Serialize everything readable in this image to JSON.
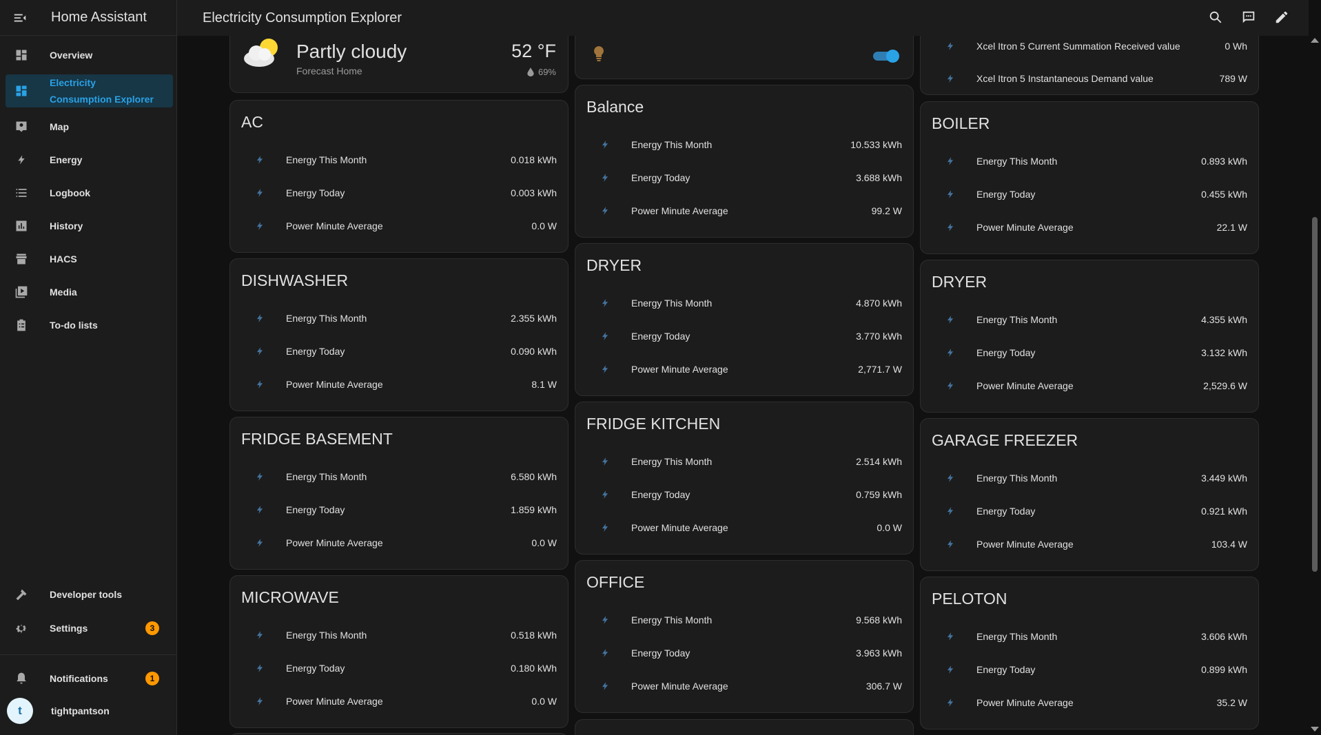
{
  "app": {
    "title": "Home Assistant"
  },
  "header": {
    "title": "Electricity Consumption Explorer"
  },
  "sidebar": {
    "items": [
      {
        "label": "Overview",
        "icon": "dashboard-icon"
      },
      {
        "label": "Electricity Consumption Explorer",
        "icon": "dashboard-icon",
        "active": true
      },
      {
        "label": "Map",
        "icon": "map-icon"
      },
      {
        "label": "Energy",
        "icon": "lightning-icon"
      },
      {
        "label": "Logbook",
        "icon": "list-icon"
      },
      {
        "label": "History",
        "icon": "chart-icon"
      },
      {
        "label": "HACS",
        "icon": "store-icon"
      },
      {
        "label": "Media",
        "icon": "media-icon"
      },
      {
        "label": "To-do lists",
        "icon": "clipboard-icon"
      }
    ],
    "developer_tools": "Developer tools",
    "settings": "Settings",
    "settings_badge": "3",
    "notifications": "Notifications",
    "notifications_badge": "1",
    "user_name": "tightpantson",
    "user_initial": "t"
  },
  "weather": {
    "condition": "Partly cloudy",
    "location": "Forecast Home",
    "temperature": "52 °F",
    "humidity": "69%"
  },
  "xcel": {
    "row1_name": "Xcel Itron 5 Current Summation Received value",
    "row1_value": "0 Wh",
    "row2_name": "Xcel Itron 5 Instantaneous Demand value",
    "row2_value": "789 W"
  },
  "row_labels": {
    "month": "Energy This Month",
    "today": "Energy Today",
    "power": "Power Minute Average"
  },
  "cards": [
    {
      "title": "AC",
      "month": "0.018 kWh",
      "today": "0.003 kWh",
      "power": "0.0 W"
    },
    {
      "title": "DISHWASHER",
      "month": "2.355 kWh",
      "today": "0.090 kWh",
      "power": "8.1 W"
    },
    {
      "title": "FRIDGE BASEMENT",
      "month": "6.580 kWh",
      "today": "1.859 kWh",
      "power": "0.0 W"
    },
    {
      "title": "MICROWAVE",
      "month": "0.518 kWh",
      "today": "0.180 kWh",
      "power": "0.0 W"
    },
    {
      "title": "Balance",
      "month": "10.533 kWh",
      "today": "3.688 kWh",
      "power": "99.2 W"
    },
    {
      "title": "DRYER",
      "month": "4.870 kWh",
      "today": "3.770 kWh",
      "power": "2,771.7 W"
    },
    {
      "title": "FRIDGE KITCHEN",
      "month": "2.514 kWh",
      "today": "0.759 kWh",
      "power": "0.0 W"
    },
    {
      "title": "OFFICE",
      "month": "9.568 kWh",
      "today": "3.963 kWh",
      "power": "306.7 W"
    },
    {
      "title": "BOILER",
      "month": "0.893 kWh",
      "today": "0.455 kWh",
      "power": "22.1 W"
    },
    {
      "title": "DRYER",
      "month": "4.355 kWh",
      "today": "3.132 kWh",
      "power": "2,529.6 W"
    },
    {
      "title": "GARAGE FREEZER",
      "month": "3.449 kWh",
      "today": "0.921 kWh",
      "power": "103.4 W"
    },
    {
      "title": "PELOTON",
      "month": "3.606 kWh",
      "today": "0.899 kWh",
      "power": "35.2 W"
    }
  ],
  "colors": {
    "accent": "#2aa2e6",
    "bolt": "#44739e",
    "badge": "#ff9800",
    "bulb": "#a0743a"
  }
}
